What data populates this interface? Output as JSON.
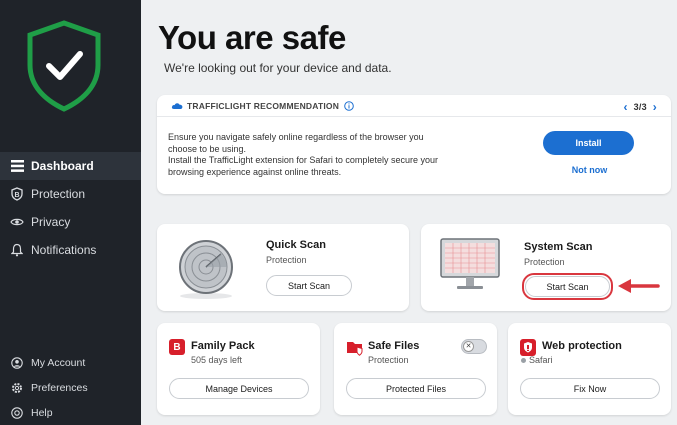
{
  "sidebar": {
    "items": [
      {
        "label": "Dashboard",
        "icon": "dashboard-icon",
        "active": true
      },
      {
        "label": "Protection",
        "icon": "shield-b-icon"
      },
      {
        "label": "Privacy",
        "icon": "eye-icon"
      },
      {
        "label": "Notifications",
        "icon": "bell-icon"
      }
    ],
    "bottom": [
      {
        "label": "My Account",
        "icon": "user-icon"
      },
      {
        "label": "Preferences",
        "icon": "gear-icon"
      },
      {
        "label": "Help",
        "icon": "help-icon"
      }
    ]
  },
  "header": {
    "title": "You are safe",
    "subtitle": "We're looking out for your device and data."
  },
  "recommendation": {
    "heading": "TRAFFICLIGHT RECOMMENDATION",
    "pager": "3/3",
    "line1": "Ensure you navigate safely online regardless of the browser you",
    "line2": "choose to be using.",
    "line3": "Install the TrafficLight extension for Safari to completely secure your",
    "line4": "browsing experience against online threats.",
    "install_label": "Install",
    "notnow_label": "Not now"
  },
  "quick_scan": {
    "title": "Quick Scan",
    "subtitle": "Protection",
    "button": "Start Scan"
  },
  "system_scan": {
    "title": "System Scan",
    "subtitle": "Protection",
    "button": "Start Scan"
  },
  "family_pack": {
    "title": "Family Pack",
    "subtitle": "505 days left",
    "button": "Manage Devices"
  },
  "safe_files": {
    "title": "Safe Files",
    "subtitle": "Protection",
    "button": "Protected Files",
    "toggle_on": false
  },
  "web_protection": {
    "title": "Web protection",
    "subtitle": "Safari",
    "button": "Fix Now"
  },
  "colors": {
    "accent": "#1c6fd1",
    "brand_red": "#d71f2b",
    "shield_green": "#1f9e47",
    "sidebar_bg": "#1f2329"
  }
}
